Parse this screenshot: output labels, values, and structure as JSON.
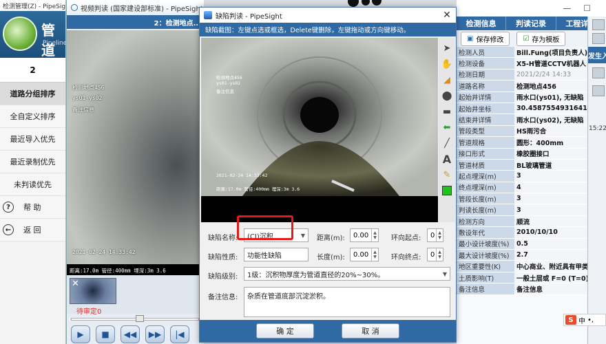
{
  "left_app": {
    "topbar_title": "检测管理(Z) - PipeSight",
    "brand": "管道",
    "brand_sub": "Pipeline",
    "page_number": "2",
    "menu": [
      {
        "label": "道路分组排序",
        "active": true
      },
      {
        "label": "全自定义排序",
        "active": false
      },
      {
        "label": "最近导入优先",
        "active": false
      },
      {
        "label": "最近录制优先",
        "active": false
      },
      {
        "label": "未判读优先",
        "active": false
      }
    ],
    "help_label": "帮 助",
    "back_label": "返 回"
  },
  "video_window": {
    "title": "视频判读 (国家建设部标准) - PipeSight",
    "subtitle": "2：检测地点...",
    "overlay": {
      "location": "检测地点456",
      "segment": "ys01-ys02",
      "remark": "备注信息",
      "datetime": "2021-02-24 14:33:42",
      "footer": "距离:17.0m 管径:400mm 埋深:3m 3.6"
    },
    "thumb_label": "待审定0"
  },
  "dialog": {
    "title": "缺陷判读 - PipeSight",
    "hint": "缺陷截图：左键点选或框选，Delete键删除，左键拖动或方向键移动。",
    "capture_overlay": {
      "location": "检测地点456",
      "segment": "ys01-ys02",
      "remark": "备注信息",
      "datetime": "2021-02-24 14:33:42",
      "footer": "距离:17.0m 管径:400mm 埋深:3m 3.6"
    },
    "form": {
      "defect_name_label": "缺陷名称:",
      "defect_name_value": "(CJ)沉积",
      "distance_label": "距离(m):",
      "distance_value": "0.00",
      "ring_start_label": "环向起点:",
      "ring_start_value": "0",
      "defect_nature_label": "缺陷性质:",
      "defect_nature_value": "功能性缺陷",
      "length_label": "长度(m):",
      "length_value": "0.00",
      "ring_end_label": "环向终点:",
      "ring_end_value": "0",
      "defect_level_label": "缺陷级别:",
      "defect_level_value": "1级：沉积物厚度为管道直径的20%~30%。",
      "remark_label": "备注信息:",
      "remark_value": "杂质在管道底部沉淀淤积。"
    },
    "ok_label": "确 定",
    "cancel_label": "取 消"
  },
  "info_panel": {
    "tabs": [
      "检测信息",
      "判读记录",
      "工程详情"
    ],
    "save_edit_label": "保存修改",
    "save_template_label": "存为模板",
    "rows": [
      {
        "k": "检测人员",
        "v": "Bill.Fung(项目负责人)"
      },
      {
        "k": "检测设备",
        "v": "X5-H管道CCTV机器人"
      },
      {
        "k": "检测日期",
        "v": "2021/2/24 14:33",
        "muted": true
      },
      {
        "k": "道路名称",
        "v": "检测地点456"
      },
      {
        "k": "起始井详情",
        "v": "雨水口(ys01), 无缺陷"
      },
      {
        "k": "起始井坐标",
        "v": "30.4587554931641,114"
      },
      {
        "k": "结束井详情",
        "v": "雨水口(ys02), 无缺陷"
      },
      {
        "k": "管段类型",
        "v": "HS雨污合"
      },
      {
        "k": "管道规格",
        "v": "圆形：400mm"
      },
      {
        "k": "接口形式",
        "v": "橡胶圈接口"
      },
      {
        "k": "管道材质",
        "v": "BL玻璃管道"
      },
      {
        "k": "起点埋深(m)",
        "v": "3"
      },
      {
        "k": "终点埋深(m)",
        "v": "4"
      },
      {
        "k": "管段长度(m)",
        "v": "3"
      },
      {
        "k": "判读长度(m)",
        "v": "3"
      },
      {
        "k": "检测方向",
        "v": "顺流"
      },
      {
        "k": "敷设年代",
        "v": "2010/10/10"
      },
      {
        "k": "最小设计坡度(%)",
        "v": "0.5"
      },
      {
        "k": "最大设计坡度(%)",
        "v": "2.7"
      },
      {
        "k": "地区重要性(K)",
        "v": "中心商业、附近具有甲类"
      },
      {
        "k": "土质影响(T)",
        "v": "一般土层或 F=0 (T=0)"
      },
      {
        "k": "备注信息",
        "v": "备注信息"
      }
    ],
    "side_text": "发生入",
    "side_time": "15:22"
  },
  "ime": {
    "label": "中",
    "symbol": "•,"
  }
}
